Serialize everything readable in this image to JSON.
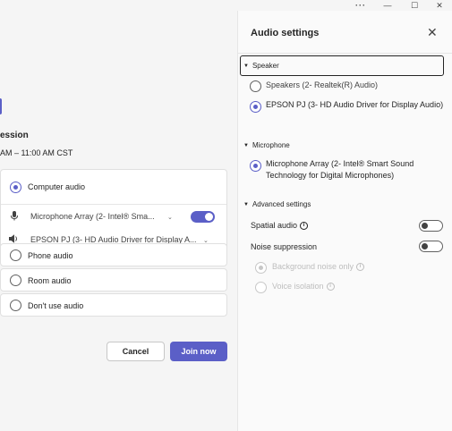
{
  "titlebar": {
    "more_icon": "more-icon",
    "more_glyph": "···",
    "minimize_glyph": "—",
    "maximize_glyph": "☐",
    "close_glyph": "✕"
  },
  "meeting": {
    "title": "ession",
    "time": "AM – 11:00 AM CST"
  },
  "audio_card": {
    "computer_audio_label": "Computer audio",
    "microphone_device": "Microphone Array (2- Intel® Sma...",
    "speaker_device": "EPSON PJ (3- HD Audio Driver for Display A...",
    "mic_toggle_on": true
  },
  "options": [
    {
      "label": "Phone audio"
    },
    {
      "label": "Room audio"
    },
    {
      "label": "Don't use audio"
    }
  ],
  "buttons": {
    "cancel": "Cancel",
    "join": "Join now"
  },
  "help_fragment": "?",
  "audio_settings": {
    "title": "Audio settings",
    "speaker_section": "Speaker",
    "speaker_options": [
      "Speakers (2- Realtek(R) Audio)",
      "EPSON PJ (3- HD Audio Driver for Display Audio)"
    ],
    "speaker_selected": 1,
    "microphone_section": "Microphone",
    "microphone_option": "Microphone Array (2- Intel® Smart Sound Technology for Digital Microphones)",
    "advanced_section": "Advanced settings",
    "spatial_audio": "Spatial audio",
    "noise_suppression": "Noise suppression",
    "background_noise_only": "Background noise only",
    "voice_isolation": "Voice isolation"
  },
  "colors": {
    "accent": "#5b5fc7",
    "background": "#f5f5f5",
    "panel": "#fafafa"
  }
}
